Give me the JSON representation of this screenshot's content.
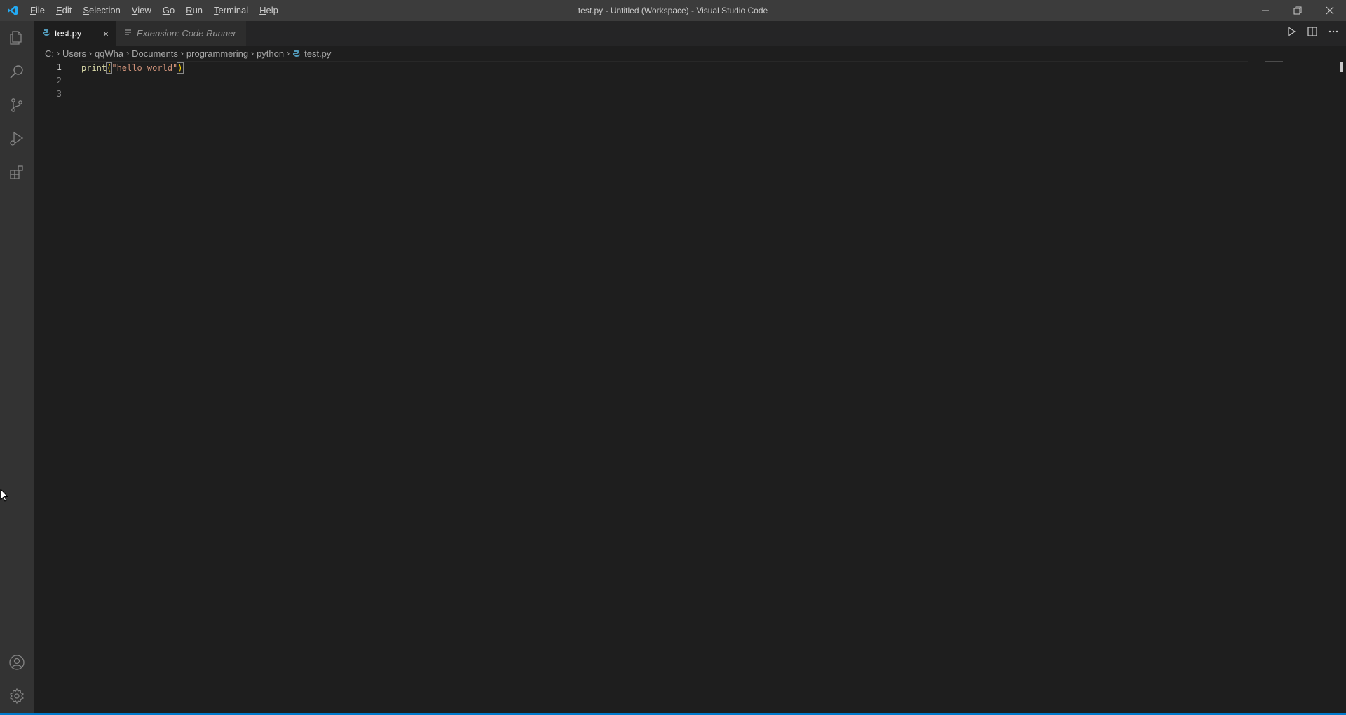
{
  "window": {
    "title": "test.py - Untitled (Workspace) - Visual Studio Code"
  },
  "menu": [
    {
      "label_mn": "F",
      "label_rest": "ile"
    },
    {
      "label_mn": "E",
      "label_rest": "dit"
    },
    {
      "label_mn": "S",
      "label_rest": "election"
    },
    {
      "label_mn": "V",
      "label_rest": "iew"
    },
    {
      "label_mn": "G",
      "label_rest": "o"
    },
    {
      "label_mn": "R",
      "label_rest": "un"
    },
    {
      "label_mn": "T",
      "label_rest": "erminal"
    },
    {
      "label_mn": "H",
      "label_rest": "elp"
    }
  ],
  "tabs": [
    {
      "label": "test.py",
      "close": "×"
    },
    {
      "label": "Extension: Code Runner"
    }
  ],
  "breadcrumb": {
    "parts": [
      "C:",
      "Users",
      "qqWha",
      "Documents",
      "programmering",
      "python"
    ],
    "file": "test.py",
    "separator": "›"
  },
  "editor": {
    "line_numbers": [
      "1",
      "2",
      "3"
    ],
    "code": {
      "fn": "print",
      "open": "(",
      "str": "\"hello world\"",
      "close": ")"
    }
  },
  "colors": {
    "accent": "#007acc",
    "python_icon": "#519aba",
    "logo": "#23a9f2"
  },
  "icons": {
    "activity": [
      "explorer-icon",
      "search-icon",
      "source-control-icon",
      "run-debug-icon",
      "extensions-icon",
      "account-icon",
      "settings-gear-icon"
    ],
    "editor_actions": [
      "run-icon",
      "split-editor-icon",
      "more-actions-icon"
    ]
  }
}
